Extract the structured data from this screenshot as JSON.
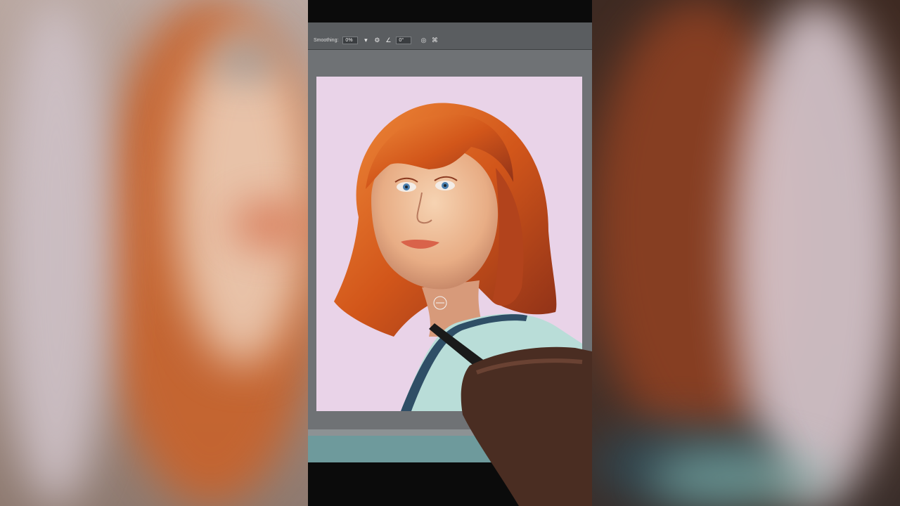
{
  "toolbar": {
    "smoothing_label": "Smoothing:",
    "smoothing_value": "0%",
    "angle_value": "0°",
    "settings_icon": "gear-icon",
    "angle_icon": "angle-icon",
    "pressure_icon": "pressure-icon",
    "symmetry_icon": "butterfly-symmetry-icon"
  },
  "canvas": {
    "background_color": "#e9d3e8",
    "subject": "portrait-painting"
  },
  "colors": {
    "hair": "#d2561a",
    "skin": "#f0c09a",
    "shirt": "#b9ddd8",
    "collar": "#2f4e66"
  }
}
